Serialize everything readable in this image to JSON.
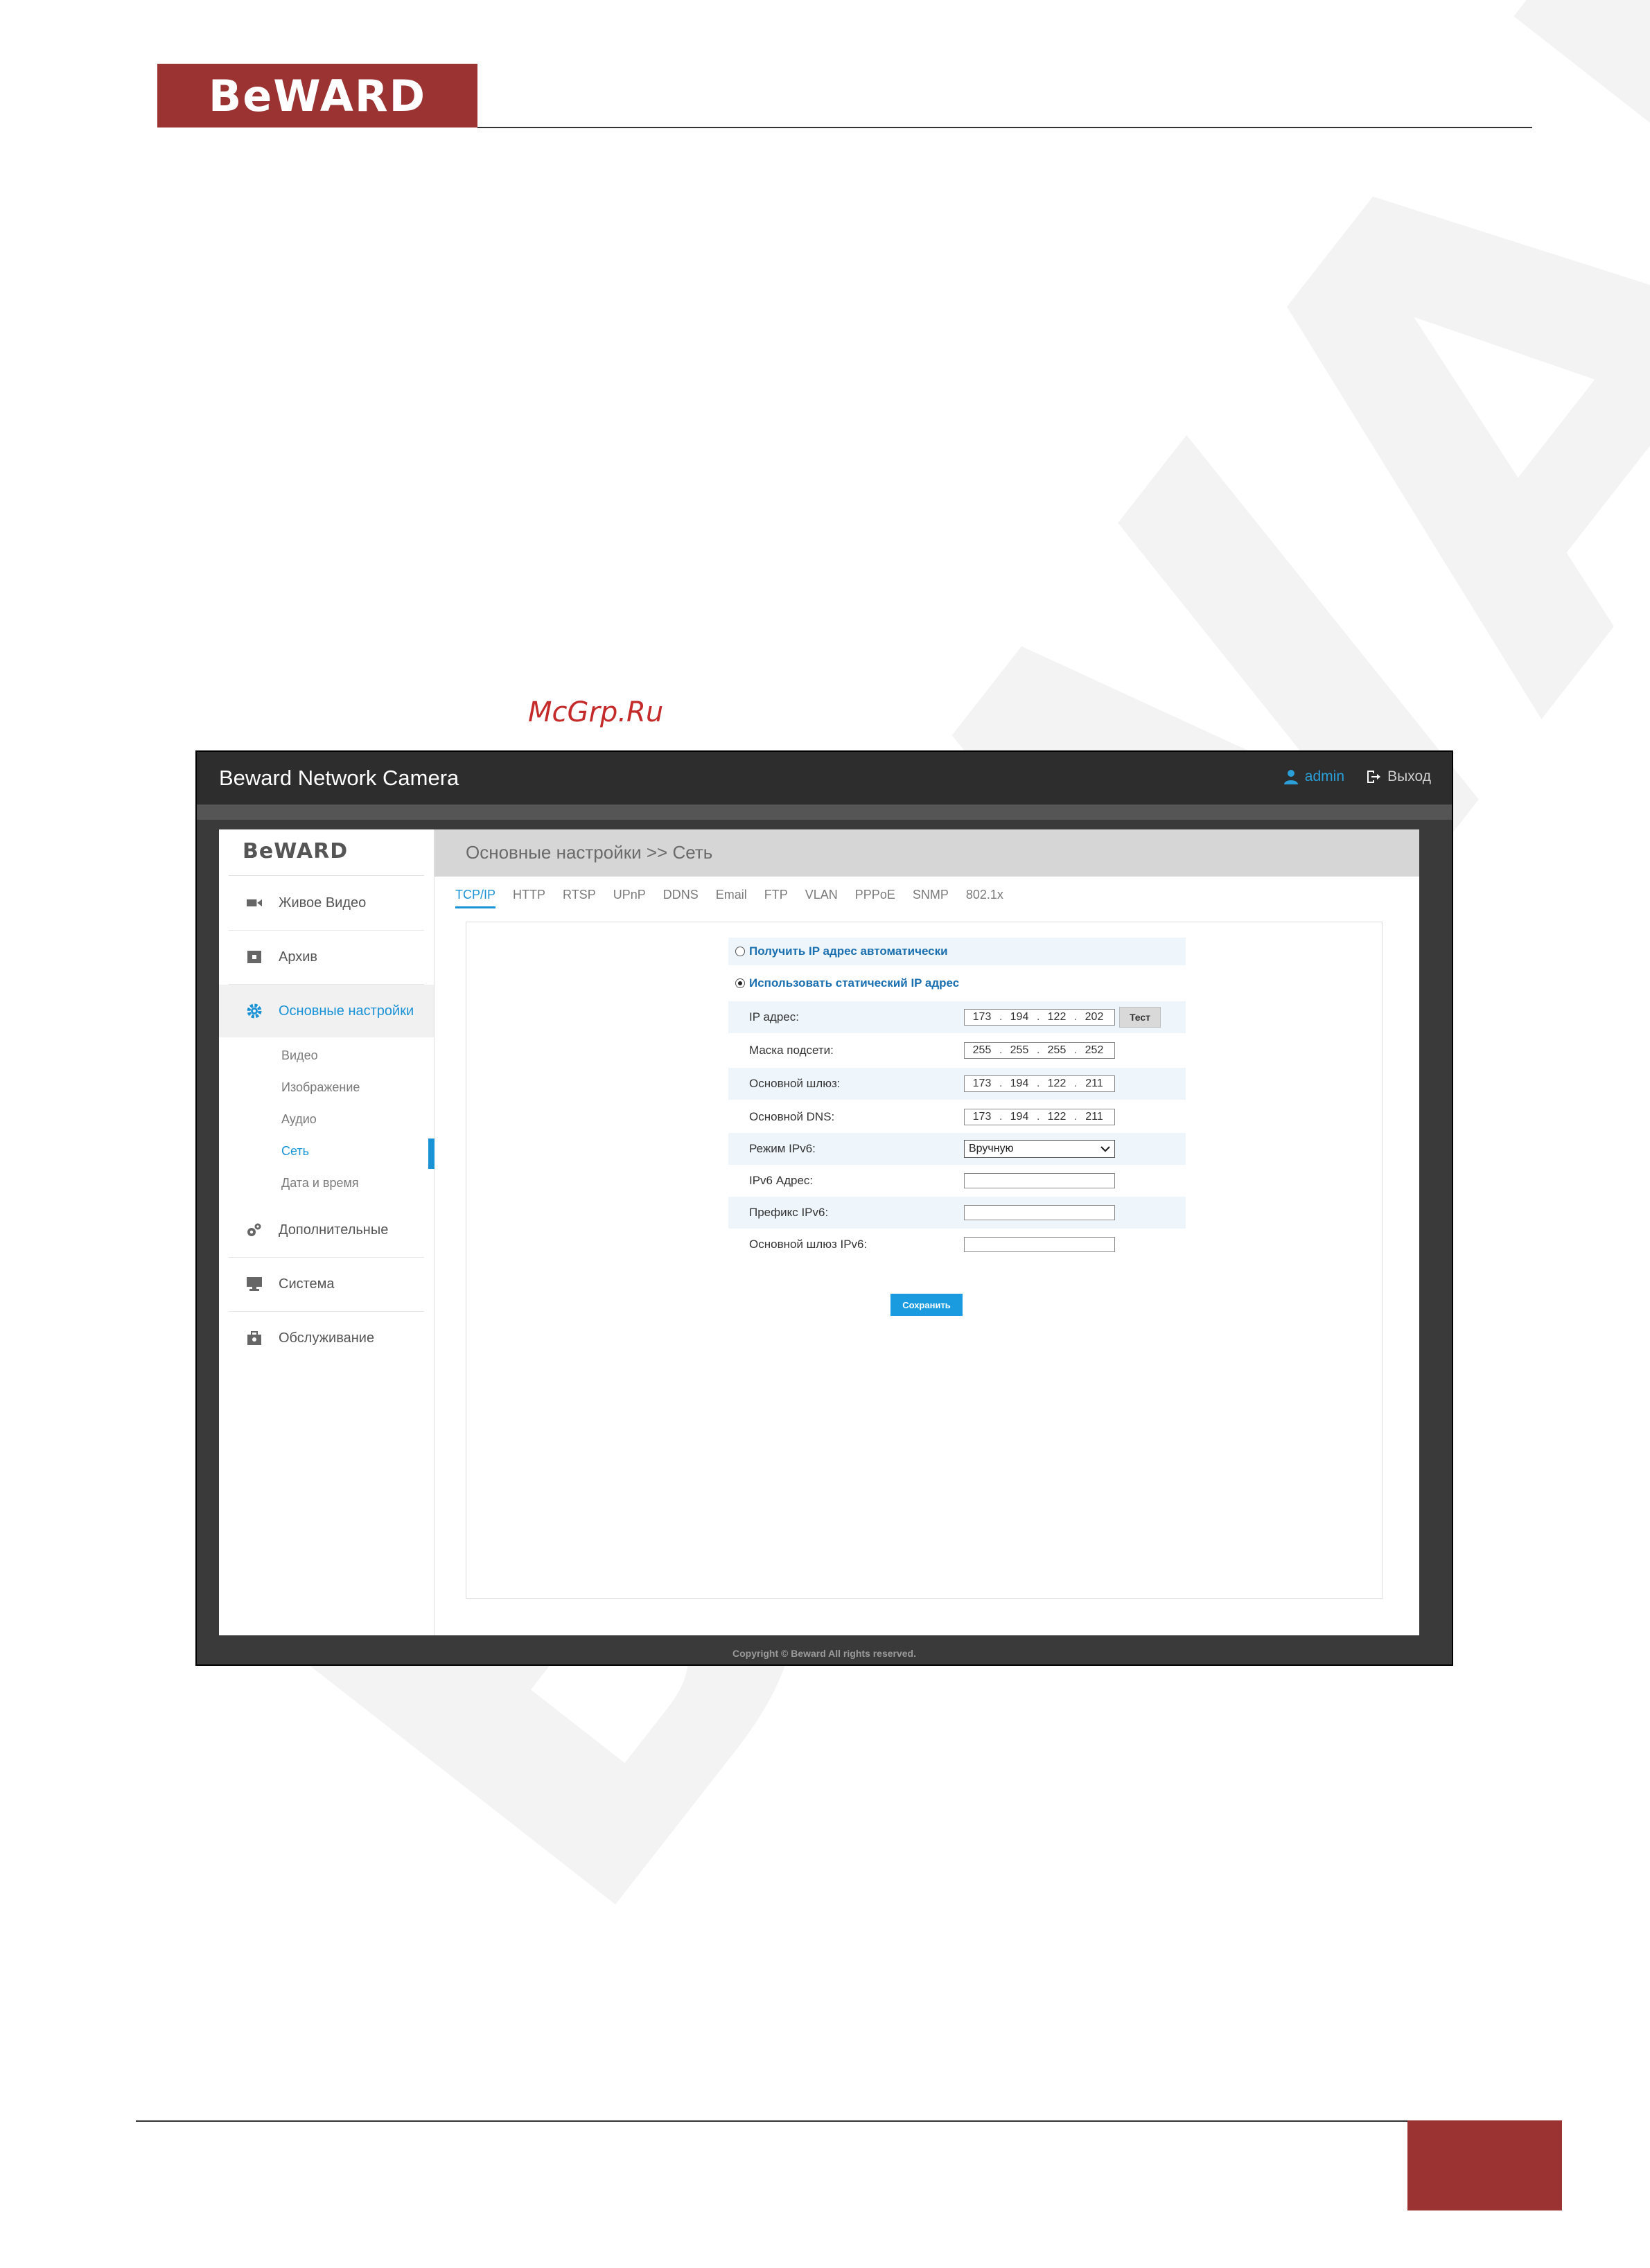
{
  "doc": {
    "logo": "BeWARD",
    "watermark": "BeWARD"
  },
  "app": {
    "title": "Beward Network Camera",
    "user": "admin",
    "logout": "Выход",
    "copyright": "Copyright © Beward All rights reserved."
  },
  "sidebar": {
    "logo": "BeWARD",
    "items": [
      {
        "label": "Живое Видео",
        "icon": "video-camera-icon"
      },
      {
        "label": "Архив",
        "icon": "archive-icon"
      },
      {
        "label": "Основные настройки",
        "icon": "gear-icon"
      },
      {
        "label": "Дополнительные",
        "icon": "gears-icon"
      },
      {
        "label": "Система",
        "icon": "monitor-icon"
      },
      {
        "label": "Обслуживание",
        "icon": "toolbox-icon"
      }
    ],
    "subitems": [
      "Видео",
      "Изображение",
      "Аудио",
      "Сеть",
      "Дата и время"
    ]
  },
  "main": {
    "title": "Основные настройки >> Сеть",
    "tabs": [
      "TCP/IP",
      "HTTP",
      "RTSP",
      "UPnP",
      "DDNS",
      "Email",
      "FTP",
      "VLAN",
      "PPPoE",
      "SNMP",
      "802.1x"
    ],
    "radio_auto": "Получить IP адрес автоматически",
    "radio_static": "Использовать статический IP адрес",
    "fields": {
      "ip_label": "IP адрес:",
      "ip": [
        "173",
        "194",
        "122",
        "202"
      ],
      "mask_label": "Маска подсети:",
      "mask": [
        "255",
        "255",
        "255",
        "252"
      ],
      "gateway_label": "Основной шлюз:",
      "gateway": [
        "173",
        "194",
        "122",
        "211"
      ],
      "dns_label": "Основной DNS:",
      "dns": [
        "173",
        "194",
        "122",
        "211"
      ],
      "ipv6_mode_label": "Режим IPv6:",
      "ipv6_mode": "Вручную",
      "ipv6_addr_label": "IPv6 Адрес:",
      "ipv6_prefix_label": "Префикс IPv6:",
      "ipv6_gateway_label": "Основной шлюз IPv6:"
    },
    "test_button": "Тест",
    "save_button": "Сохранить"
  },
  "site_watermark": "McGrp.Ru",
  "colors": {
    "brand_red": "#9b3333",
    "accent_blue": "#1a93d6",
    "header_dark": "#2d2d2d"
  }
}
